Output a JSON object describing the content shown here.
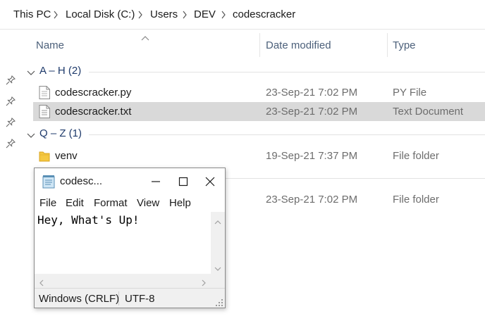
{
  "breadcrumb": {
    "items": [
      "This PC",
      "Local Disk (C:)",
      "Users",
      "DEV",
      "codescracker"
    ],
    "separator_icon": "chevron-right-icon"
  },
  "columns": {
    "name": "Name",
    "date": "Date modified",
    "type": "Type",
    "sort_icon": "sort-up-icon"
  },
  "groups": [
    {
      "label": "A – H (2)",
      "items": [
        {
          "name": "codescracker.py",
          "date": "23-Sep-21 7:02 PM",
          "type": "PY File",
          "icon": "python-file-icon",
          "selected": false
        },
        {
          "name": "codescracker.txt",
          "date": "23-Sep-21 7:02 PM",
          "type": "Text Document",
          "icon": "text-file-icon",
          "selected": true
        }
      ]
    },
    {
      "label": "Q – Z (1)",
      "items": [
        {
          "name": "venv",
          "date": "19-Sep-21 7:37 PM",
          "type": "File folder",
          "icon": "folder-icon",
          "selected": false
        }
      ]
    }
  ],
  "hidden_row": {
    "date": "23-Sep-21 7:02 PM",
    "type": "File folder"
  },
  "notepad": {
    "title": "codesc...",
    "menu": [
      "File",
      "Edit",
      "Format",
      "View",
      "Help"
    ],
    "content": "Hey, What's Up!",
    "status": {
      "line_ending": "Windows (CRLF)",
      "encoding": "UTF-8"
    }
  },
  "colors": {
    "selection": "#d9d9d9",
    "group_label": "#1e3a6b",
    "column_header": "#4c607a",
    "folder": "#f5c842"
  }
}
